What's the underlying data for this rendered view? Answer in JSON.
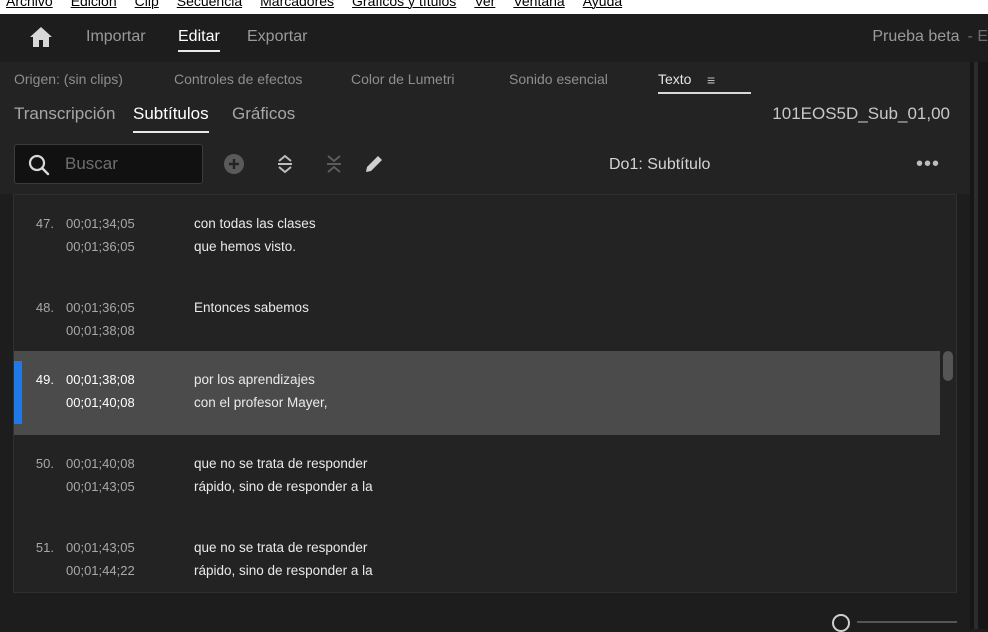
{
  "menu": [
    "Archivo",
    "Edición",
    "Clip",
    "Secuencia",
    "Marcadores",
    "Gráficos y títulos",
    "Ver",
    "Ventana",
    "Ayuda"
  ],
  "workspaces": {
    "import": "Importar",
    "edit": "Editar",
    "export": "Exportar"
  },
  "beta": {
    "label": "Prueba beta",
    "suffix": "- E"
  },
  "panel_tabs": {
    "source": "Origen: (sin clips)",
    "effect_controls": "Controles de efectos",
    "lumetri": "Color de Lumetri",
    "essential_sound": "Sonido esencial",
    "text": "Texto",
    "menu": "≡"
  },
  "sub_tabs": {
    "transcription": "Transcripción",
    "captions": "Subtítulos",
    "graphics": "Gráficos"
  },
  "sequence_name": "101EOS5D_Sub_01,00",
  "search": {
    "placeholder": "Buscar",
    "value": ""
  },
  "track_label": "Do1: Subtítulo",
  "more_label": "•••",
  "captions": [
    {
      "num": "47.",
      "start": "00;01;34;05",
      "end": "00;01;36;05",
      "line1": "con todas las clases",
      "line2": "que hemos visto.",
      "selected": false
    },
    {
      "num": "48.",
      "start": "00;01;36;05",
      "end": "00;01;38;08",
      "line1": "Entonces sabemos",
      "line2": "",
      "selected": false
    },
    {
      "num": "49.",
      "start": "00;01;38;08",
      "end": "00;01;40;08",
      "line1": "por los aprendizajes",
      "line2": "con el profesor Mayer,",
      "selected": true
    },
    {
      "num": "50.",
      "start": "00;01;40;08",
      "end": "00;01;43;05",
      "line1": "que no se trata de responder",
      "line2": "rápido, sino de responder a la",
      "selected": false
    },
    {
      "num": "51.",
      "start": "00;01;43;05",
      "end": "00;01;44;22",
      "line1": "que no se trata de responder",
      "line2": "rápido, sino de responder a la",
      "selected": false
    }
  ],
  "colors": {
    "accent": "#1f7ae8",
    "selected_row": "#4b4b4b",
    "panel": "#232323",
    "background": "#1d1d1d"
  }
}
